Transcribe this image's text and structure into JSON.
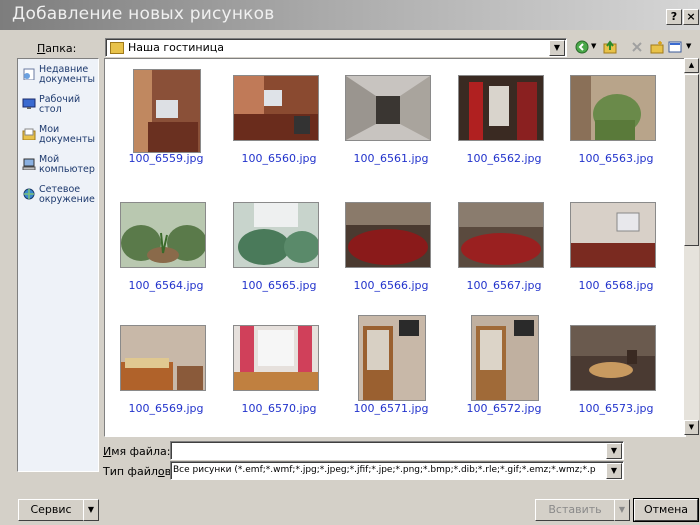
{
  "window": {
    "title": "Добавление новых рисунков",
    "help_glyph": "?",
    "close_glyph": "×"
  },
  "folder": {
    "label": "Папка:",
    "label_hotkey": "П",
    "label_rest": "апка:",
    "value": "Наша гостиница"
  },
  "places": [
    {
      "label": "Недавние документы",
      "icon": "recent-docs-icon"
    },
    {
      "label": "Рабочий стол",
      "icon": "desktop-icon"
    },
    {
      "label": "Мои документы",
      "icon": "my-documents-icon"
    },
    {
      "label": "Мой компьютер",
      "icon": "my-computer-icon"
    },
    {
      "label": "Сетевое окружение",
      "icon": "network-icon"
    }
  ],
  "files": [
    "100_6559.jpg",
    "100_6560.jpg",
    "100_6561.jpg",
    "100_6562.jpg",
    "100_6563.jpg",
    "100_6564.jpg",
    "100_6565.jpg",
    "100_6566.jpg",
    "100_6567.jpg",
    "100_6568.jpg",
    "100_6569.jpg",
    "100_6570.jpg",
    "100_6571.jpg",
    "100_6572.jpg",
    "100_6573.jpg"
  ],
  "filename": {
    "label": "Имя файла:",
    "label_hotkey": "И",
    "label_rest": "мя файла:",
    "value": ""
  },
  "filetype": {
    "label": "Тип файлов:",
    "label_hotkey": "Тип файл",
    "label_rest_underlined": "о",
    "label_tail": "в:",
    "value": "Все рисунки (*.emf;*.wmf;*.jpg;*.jpeg;*.jfif;*.jpe;*.png;*.bmp;*.dib;*.rle;*.gif;*.emz;*.wmz;*.p"
  },
  "buttons": {
    "service": "Сервис",
    "insert": "Вставить",
    "cancel": "Отмена"
  },
  "colors": {
    "link": "#2233cc",
    "face": "#d4d0c8",
    "title_start": "#7d7d7d"
  }
}
